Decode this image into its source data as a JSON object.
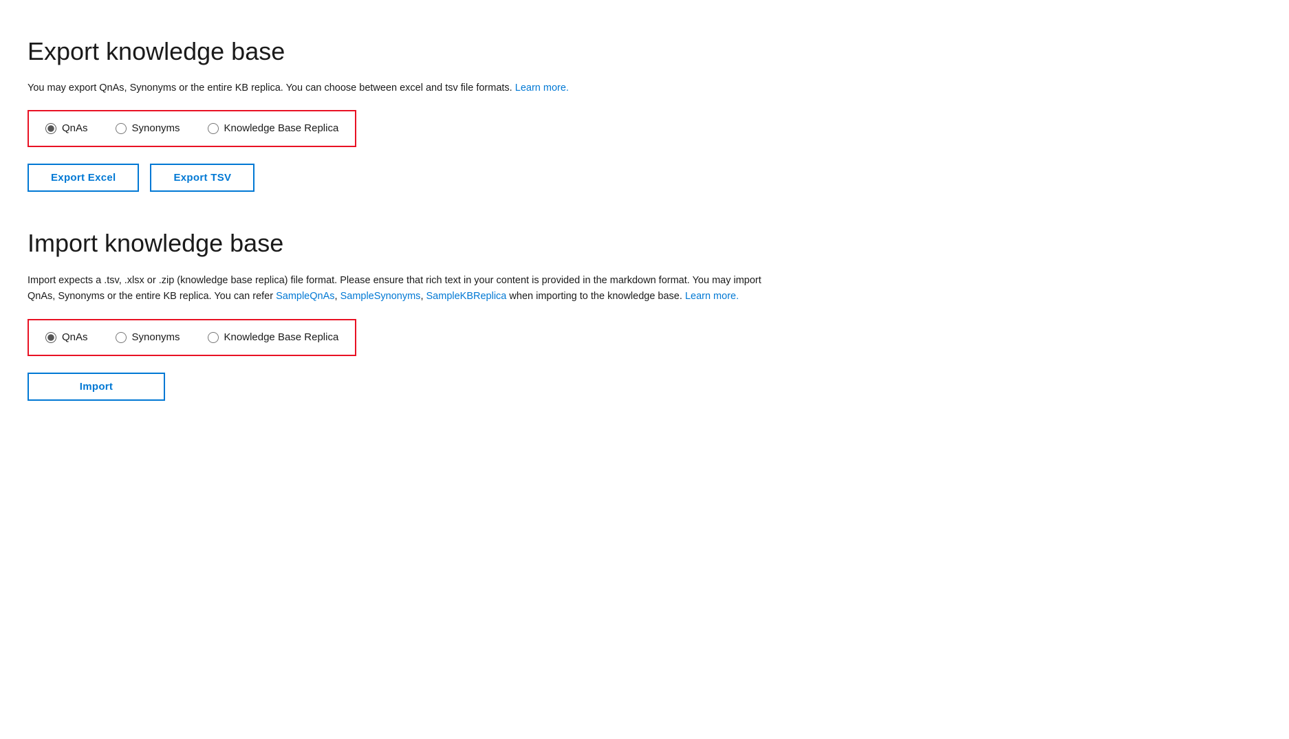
{
  "export_section": {
    "title": "Export knowledge base",
    "description_text": "You may export QnAs, Synonyms or the entire KB replica. You can choose between excel and tsv file formats.",
    "learn_more_label": "Learn more.",
    "learn_more_url": "#",
    "radio_group": {
      "options": [
        {
          "id": "export-qnas",
          "label": "QnAs",
          "checked": true
        },
        {
          "id": "export-synonyms",
          "label": "Synonyms",
          "checked": false
        },
        {
          "id": "export-kbreplica",
          "label": "Knowledge Base Replica",
          "checked": false
        }
      ]
    },
    "buttons": [
      {
        "id": "export-excel-btn",
        "label": "Export Excel"
      },
      {
        "id": "export-tsv-btn",
        "label": "Export TSV"
      }
    ]
  },
  "import_section": {
    "title": "Import knowledge base",
    "description_line1": "Import expects a .tsv, .xlsx or .zip (knowledge base replica) file format. Please ensure that rich text in your content is provided in the",
    "description_line1b": "markdown format. You may import QnAs, Synonyms or the entire KB replica. You can refer",
    "sample_qnas_label": "SampleQnAs",
    "sample_synonyms_label": "SampleSynonyms",
    "sample_kbreplica_label": "SampleKBReplica",
    "description_when": "when importing to the knowledge base.",
    "learn_more_label": "Learn more.",
    "radio_group": {
      "options": [
        {
          "id": "import-qnas",
          "label": "QnAs",
          "checked": true
        },
        {
          "id": "import-synonyms",
          "label": "Synonyms",
          "checked": false
        },
        {
          "id": "import-kbreplica",
          "label": "Knowledge Base Replica",
          "checked": false
        }
      ]
    },
    "import_button_label": "Import"
  }
}
